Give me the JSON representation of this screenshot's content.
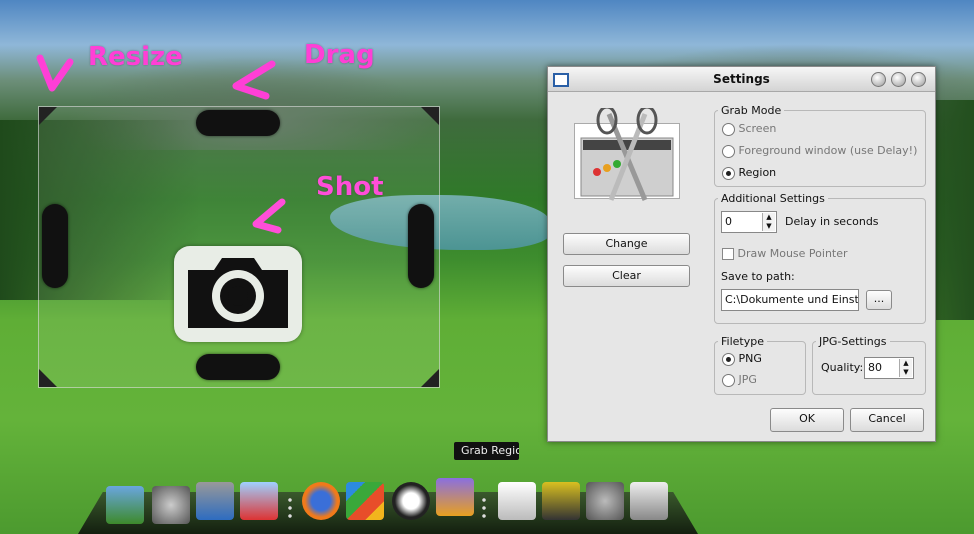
{
  "annotations": {
    "resize": "Resize",
    "drag": "Drag",
    "shot": "Shot"
  },
  "capture_frame": {
    "camera_icon": "camera-icon"
  },
  "settings_window": {
    "title": "Settings",
    "change_label": "Change",
    "clear_label": "Clear",
    "grab_mode": {
      "label": "Grab Mode",
      "options": [
        "Screen",
        "Foreground window (use Delay!)",
        "Region"
      ],
      "selected": "Region"
    },
    "additional": {
      "label": "Additional Settings",
      "delay_value": "0",
      "delay_label": "Delay in seconds",
      "draw_mouse_label": "Draw Mouse Pointer",
      "save_path_label": "Save to path:",
      "save_path_value": "C:\\Dokumente und Einstellu",
      "browse_label": "..."
    },
    "filetype": {
      "label": "Filetype",
      "options": [
        "PNG",
        "JPG"
      ],
      "selected": "PNG"
    },
    "jpg_settings": {
      "label": "JPG-Settings",
      "quality_label": "Quality:",
      "quality_value": "80"
    },
    "ok_label": "OK",
    "cancel_label": "Cancel"
  },
  "tooltip": "Grab Region",
  "dock": {
    "icons": [
      "landscape-photo-icon",
      "disk-utility-icon",
      "archive-icon",
      "nike-folder-icon",
      "firefox-icon",
      "zip-app-icon",
      "nasa-astronaut-icon",
      "toolbox-icon",
      "grab-scissors-icon",
      "trash-bin-icon",
      "system-preferences-icon",
      "recycle-bin-icon"
    ]
  },
  "colors": {
    "annotation": "#ff3fd6",
    "window_bg": "#e6e6e6"
  }
}
